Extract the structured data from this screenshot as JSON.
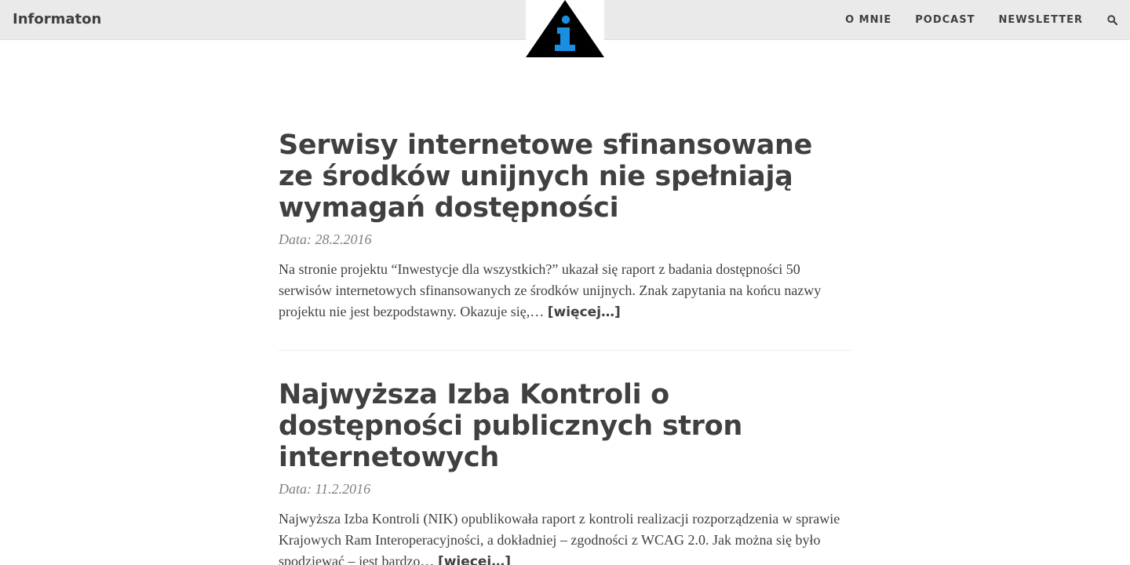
{
  "nav": {
    "brand": "Informaton",
    "links": [
      "O MNIE",
      "PODCAST",
      "NEWSLETTER"
    ],
    "search_icon": "search-icon",
    "logo_icon": "info-triangle-logo"
  },
  "colors": {
    "navbar_bg": "#eaeaea",
    "text": "#404040",
    "meta": "#808080",
    "logo_accent": "#1a8fe0"
  },
  "posts": [
    {
      "title": "Serwisy internetowe sfinansowane ze środków unijnych nie spełniają wymagań dostępności",
      "date": "Data: 28.2.2016",
      "excerpt": "Na stronie projektu “Inwestycje dla wszystkich?” ukazał się raport z badania dostępności 50 serwisów internetowych sfinansowanych ze środków unijnych. Znak zapytania na końcu nazwy projektu nie jest bezpodstawny. Okazuje się,…",
      "more": "[więcej…]"
    },
    {
      "title": "Najwyższa Izba Kontroli o dostępności publicznych stron internetowych",
      "date": "Data: 11.2.2016",
      "excerpt": "Najwyższa Izba Kontroli (NIK) opublikowała raport z kontroli realizacji rozporządzenia w sprawie Krajowych Ram Interoperacyjności, a dokładniej – zgodności z WCAG 2.0. Jak można się było spodziewać – jest bardzo…",
      "more": "[więcej…]"
    }
  ]
}
